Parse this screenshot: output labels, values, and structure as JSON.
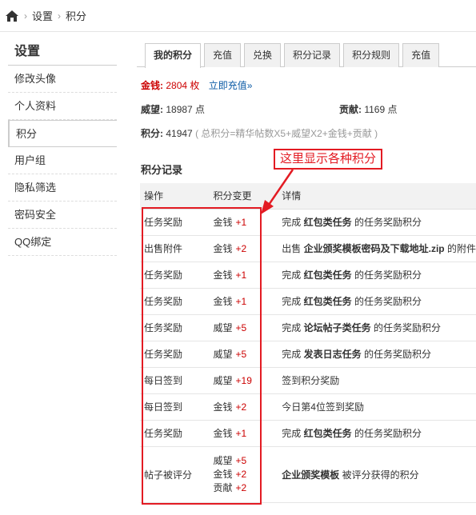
{
  "breadcrumb": {
    "items": [
      "设置",
      "积分"
    ]
  },
  "sidebar": {
    "title": "设置",
    "items": [
      {
        "label": "修改头像"
      },
      {
        "label": "个人资料"
      },
      {
        "label": "积分"
      },
      {
        "label": "用户组"
      },
      {
        "label": "隐私筛选"
      },
      {
        "label": "密码安全"
      },
      {
        "label": "QQ绑定"
      }
    ],
    "active_index": 2
  },
  "tabs": [
    "我的积分",
    "充值",
    "兑换",
    "积分记录",
    "积分规则",
    "充值"
  ],
  "summary": {
    "money_label": "金钱:",
    "money_value": "2804 枚",
    "recharge_link": "立即充值»",
    "weiwang_label": "威望:",
    "weiwang_value": "18987 点",
    "gongxian_label": "贡献:",
    "gongxian_value": "1169 点",
    "total_label": "积分:",
    "total_value": "41947",
    "total_formula": "( 总积分=精华帖数X5+威望X2+金钱+贡献 )"
  },
  "log": {
    "title": "积分记录",
    "headers": [
      "操作",
      "积分变更",
      "详情"
    ],
    "rows": [
      {
        "op": "任务奖励",
        "changes": [
          {
            "type": "金钱",
            "amount": "+1"
          }
        ],
        "detail_pre": "完成",
        "detail_bold": "红包类任务",
        "detail_post": "的任务奖励积分"
      },
      {
        "op": "出售附件",
        "changes": [
          {
            "type": "金钱",
            "amount": "+2"
          }
        ],
        "detail_pre": "出售",
        "detail_bold": "企业颁奖模板密码及下载地址.zip",
        "detail_post": "的附件"
      },
      {
        "op": "任务奖励",
        "changes": [
          {
            "type": "金钱",
            "amount": "+1"
          }
        ],
        "detail_pre": "完成",
        "detail_bold": "红包类任务",
        "detail_post": "的任务奖励积分"
      },
      {
        "op": "任务奖励",
        "changes": [
          {
            "type": "金钱",
            "amount": "+1"
          }
        ],
        "detail_pre": "完成",
        "detail_bold": "红包类任务",
        "detail_post": "的任务奖励积分"
      },
      {
        "op": "任务奖励",
        "changes": [
          {
            "type": "威望",
            "amount": "+5"
          }
        ],
        "detail_pre": "完成",
        "detail_bold": "论坛帖子类任务",
        "detail_post": "的任务奖励积分"
      },
      {
        "op": "任务奖励",
        "changes": [
          {
            "type": "威望",
            "amount": "+5"
          }
        ],
        "detail_pre": "完成",
        "detail_bold": "发表日志任务",
        "detail_post": "的任务奖励积分"
      },
      {
        "op": "每日签到",
        "changes": [
          {
            "type": "威望",
            "amount": "+19"
          }
        ],
        "detail_pre": "签到积分奖励",
        "detail_bold": "",
        "detail_post": ""
      },
      {
        "op": "每日签到",
        "changes": [
          {
            "type": "金钱",
            "amount": "+2"
          }
        ],
        "detail_pre": "今日第4位签到奖励",
        "detail_bold": "",
        "detail_post": ""
      },
      {
        "op": "任务奖励",
        "changes": [
          {
            "type": "金钱",
            "amount": "+1"
          }
        ],
        "detail_pre": "完成",
        "detail_bold": "红包类任务",
        "detail_post": "的任务奖励积分"
      },
      {
        "op": "帖子被评分",
        "changes": [
          {
            "type": "威望",
            "amount": "+5"
          },
          {
            "type": "金钱",
            "amount": "+2"
          },
          {
            "type": "贡献",
            "amount": "+2"
          }
        ],
        "detail_pre": "",
        "detail_bold": "企业颁奖模板",
        "detail_post": "被评分获得的积分"
      }
    ]
  },
  "annotation": {
    "text": "这里显示各种积分",
    "color": "#e31b23"
  },
  "colors": {
    "accent_red": "#cc0000",
    "link_blue": "#0a5aa5",
    "annotation_red": "#e31b23"
  }
}
